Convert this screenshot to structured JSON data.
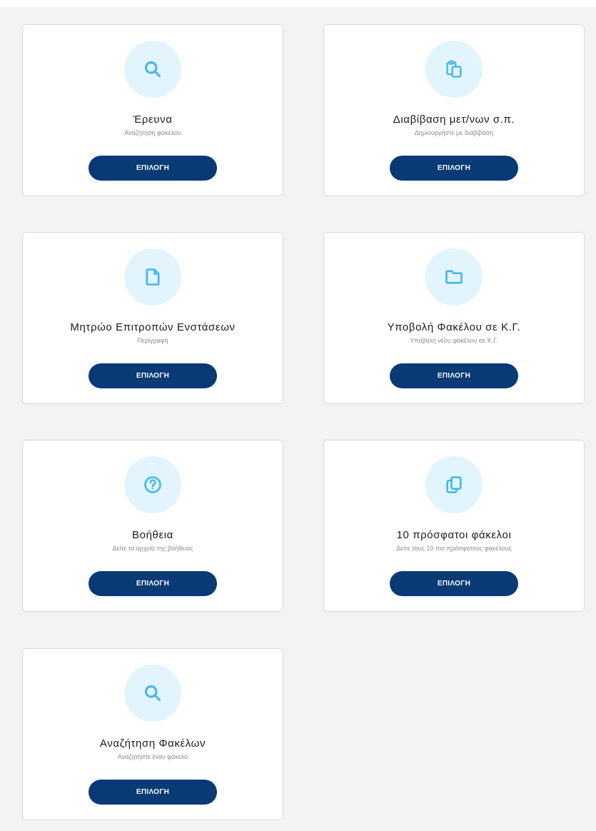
{
  "accent_color": "#0a3a75",
  "icon_color": "#41b6ea",
  "icon_bg_color": "#e2f4fd",
  "cards": [
    {
      "icon": "search-icon",
      "title": "Έρευνα",
      "subtitle": "Αναζήτηση φακέλου",
      "button": "ΕΠΙΛΟΓΗ"
    },
    {
      "icon": "clipboard-copy-icon",
      "title": "Διαβίβαση μετ/νων σ.π.",
      "subtitle": "Δημιουργήστε με διαβίβαση",
      "button": "ΕΠΙΛΟΓΗ"
    },
    {
      "icon": "document-icon",
      "title": "Μητρώο Επιτροπών Ενστάσεων",
      "subtitle": "Περιγραφή",
      "button": "ΕΠΙΛΟΓΗ"
    },
    {
      "icon": "folder-icon",
      "title": "Υποβολή Φακέλου σε Κ.Γ.",
      "subtitle": "Υποβολή νέου φακέλου σε Κ.Γ.",
      "button": "ΕΠΙΛΟΓΗ"
    },
    {
      "icon": "help-icon",
      "title": "Βοήθεια",
      "subtitle": "Δείτε τα αρχεία της βοήθειας",
      "button": "ΕΠΙΛΟΓΗ"
    },
    {
      "icon": "copy-icon",
      "title": "10 πρόσφατοι φάκελοι",
      "subtitle": "Δείτε τους 10 πιο πρόσφατους φακέλους",
      "button": "ΕΠΙΛΟΓΗ"
    },
    {
      "icon": "search-icon",
      "title": "Αναζήτηση Φακέλων",
      "subtitle": "Αναζητήστε έναν φάκελο",
      "button": "ΕΠΙΛΟΓΗ"
    }
  ]
}
